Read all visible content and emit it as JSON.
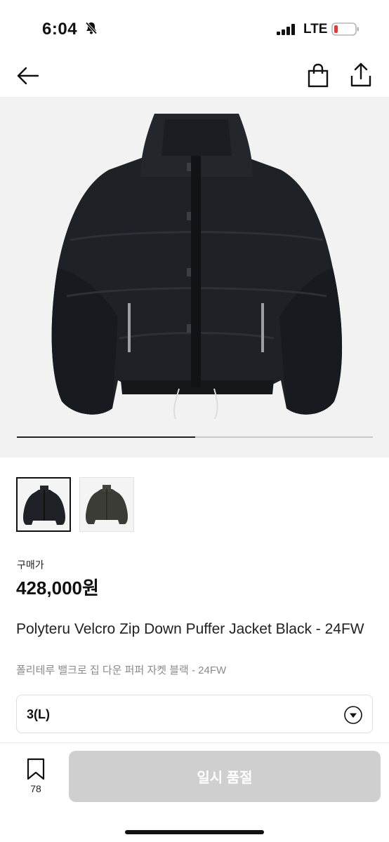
{
  "status_bar": {
    "time": "6:04",
    "carrier": "LTE",
    "battery_color": "#e53935"
  },
  "gallery": {
    "image_count": 2,
    "current_index": 1,
    "progress": 0.5
  },
  "product": {
    "price_label": "구매가",
    "price": "428,000원",
    "name_en": "Polyteru Velcro Zip Down Puffer Jacket Black - 24FW",
    "name_ko": "폴리테루 밸크로 집 다운 퍼퍼 자켓 블랙 - 24FW"
  },
  "option": {
    "selected": "3(L)"
  },
  "bottom_bar": {
    "wish_count": "78",
    "buy_label": "일시 품절"
  },
  "icons": {
    "back": "arrow-left-icon",
    "bag": "shopping-bag-icon",
    "share": "share-icon",
    "dropdown": "chevron-down-circle-icon",
    "wish": "bookmark-icon"
  }
}
